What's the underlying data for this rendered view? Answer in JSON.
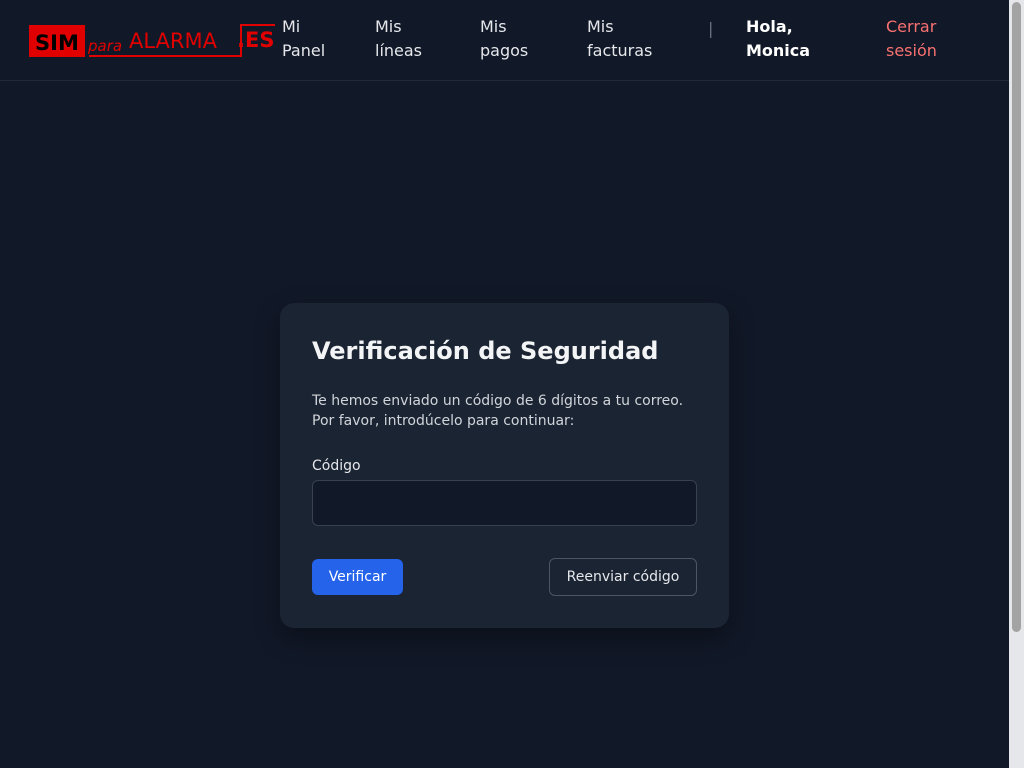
{
  "brand": {
    "logo_part1": "SIM",
    "logo_part2": "para",
    "logo_part3": "ALARMA",
    "logo_part4": ".ES",
    "logo_color": "#e00000"
  },
  "nav": {
    "items": [
      {
        "line1": "Mi",
        "line2": "Panel"
      },
      {
        "line1": "Mis",
        "line2": "líneas"
      },
      {
        "line1": "Mis",
        "line2": "pagos"
      },
      {
        "line1": "Mis",
        "line2": "facturas"
      }
    ],
    "separator": "|",
    "greeting_line1": "Hola,",
    "greeting_line2": "Monica",
    "logout_line1": "Cerrar",
    "logout_line2": "sesión"
  },
  "verification": {
    "title": "Verificación de Seguridad",
    "description_line1": "Te hemos enviado un código de 6 dígitos a tu correo.",
    "description_line2": "Por favor, introdúcelo para continuar:",
    "code_label": "Código",
    "code_value": "",
    "code_placeholder": "",
    "verify_button": "Verificar",
    "resend_button": "Reenviar código"
  },
  "colors": {
    "background": "#111827",
    "card": "#1b2432",
    "primary": "#2563eb",
    "logout": "#f87171"
  }
}
